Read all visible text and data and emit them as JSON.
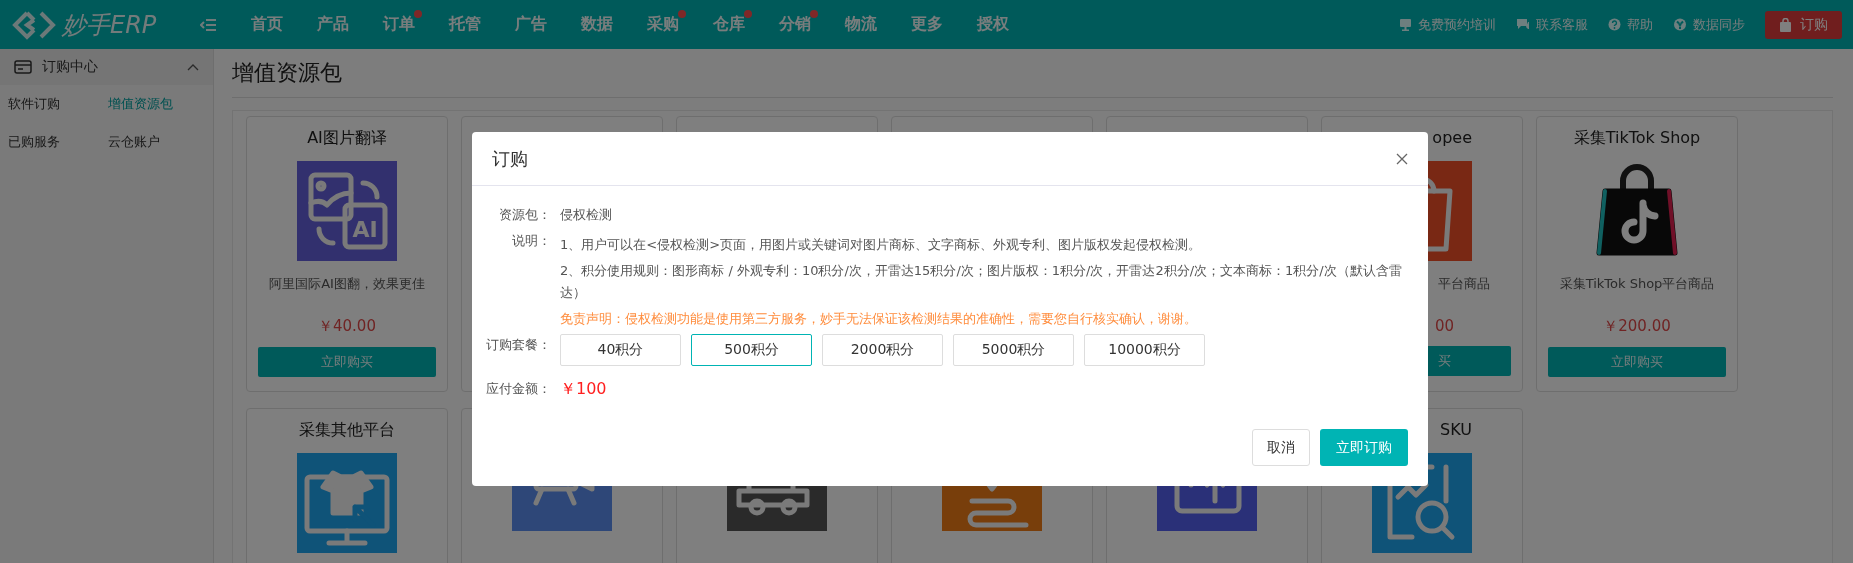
{
  "header": {
    "logo": "妙手ERP",
    "nav": [
      {
        "label": "首页",
        "dot": false
      },
      {
        "label": "产品",
        "dot": false
      },
      {
        "label": "订单",
        "dot": true
      },
      {
        "label": "托管",
        "dot": false
      },
      {
        "label": "广告",
        "dot": false
      },
      {
        "label": "数据",
        "dot": false
      },
      {
        "label": "采购",
        "dot": true
      },
      {
        "label": "仓库",
        "dot": true
      },
      {
        "label": "分销",
        "dot": true
      },
      {
        "label": "物流",
        "dot": false
      },
      {
        "label": "更多",
        "dot": false
      },
      {
        "label": "授权",
        "dot": false
      }
    ],
    "links": [
      "免费预约培训",
      "联系客服",
      "帮助",
      "数据同步"
    ],
    "order_button": "订购"
  },
  "sidebar": {
    "section": {
      "title": "订购中心",
      "expanded": true
    },
    "items": [
      {
        "label": "软件订购",
        "selected": false
      },
      {
        "label": "增值资源包",
        "selected": true
      },
      {
        "label": "已购服务",
        "selected": false
      },
      {
        "label": "云仓账户",
        "selected": false
      }
    ]
  },
  "page_title": "增值资源包",
  "card_rows": [
    {
      "cards": [
        {
          "kind": "full",
          "title": "AI图片翻译",
          "icon_label": "AI",
          "description": "阿里国际AI图翻，效果更佳",
          "price": "￥40.00",
          "button": "立即购买"
        },
        {
          "kind": "hidden"
        },
        {
          "kind": "hidden"
        },
        {
          "kind": "hidden"
        },
        {
          "kind": "hidden"
        },
        {
          "kind": "partial",
          "title": "opee",
          "description": "平台商品",
          "price": "00",
          "button": "买"
        },
        {
          "kind": "full",
          "title": "采集TikTok Shop",
          "description": "采集TikTok Shop平台商品",
          "price": "￥200.00",
          "button": "立即购买"
        }
      ]
    },
    {
      "cards": [
        {
          "kind": "full",
          "title": "采集其他平台"
        },
        {
          "kind": "hidden"
        },
        {
          "kind": "hidden"
        },
        {
          "kind": "hidden"
        },
        {
          "kind": "hidden"
        },
        {
          "kind": "partial",
          "title": "SKU"
        }
      ]
    }
  ],
  "dialog": {
    "title": "订购",
    "package_label": "资源包：",
    "package": "侵权检测",
    "notes_label": "说明：",
    "notes": [
      "1、用户可以在<侵权检测>页面，用图片或关键词对图片商标、文字商标、外观专利、图片版权发起侵权检测。",
      "2、积分使用规则：图形商标 / 外观专利：10积分/次，开雷达15积分/次；图片版权：1积分/次，开雷达2积分/次；文本商标：1积分/次（默认含雷达）"
    ],
    "disclaimer": "免责声明：侵权检测功能是使用第三方服务，妙手无法保证该检测结果的准确性，需要您自行核实确认，谢谢。",
    "plans_label": "订购套餐：",
    "plans": [
      {
        "label": "40积分",
        "selected": false
      },
      {
        "label": "500积分",
        "selected": true
      },
      {
        "label": "2000积分",
        "selected": false
      },
      {
        "label": "5000积分",
        "selected": false
      },
      {
        "label": "10000积分",
        "selected": false
      }
    ],
    "amount_label": "应付金额：",
    "amount": "￥100",
    "cancel": "取消",
    "confirm": "立即订购"
  }
}
